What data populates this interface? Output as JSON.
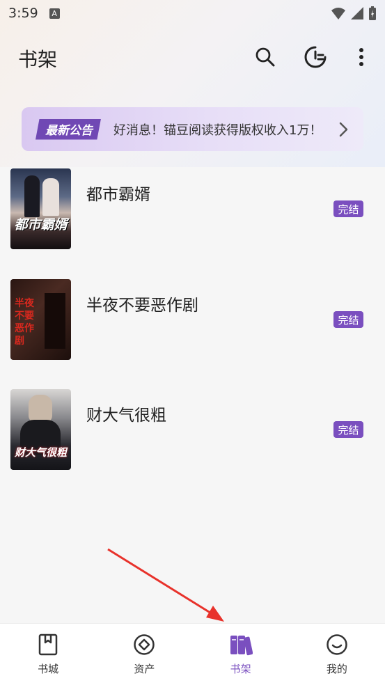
{
  "status": {
    "time": "3:59",
    "notification_letter": "A"
  },
  "header": {
    "title": "书架"
  },
  "notice": {
    "tag": "最新公告",
    "text": "好消息！锚豆阅读获得版权收入1万！"
  },
  "books": [
    {
      "title": "都市霸婿",
      "badge": "完结",
      "cover_text": "都市霸婿"
    },
    {
      "title": "半夜不要恶作剧",
      "badge": "完结",
      "cover_text": "半夜不要恶作剧"
    },
    {
      "title": "财大气很粗",
      "badge": "完结",
      "cover_text": "财大气很粗"
    }
  ],
  "tabbar": {
    "items": [
      {
        "label": "书城",
        "icon": "bookstore-icon"
      },
      {
        "label": "资产",
        "icon": "assets-icon"
      },
      {
        "label": "书架",
        "icon": "bookshelf-icon",
        "active": true
      },
      {
        "label": "我的",
        "icon": "profile-icon"
      }
    ]
  },
  "colors": {
    "accent": "#7a4fbf",
    "notice_tag": "#7048b4",
    "annotation_arrow": "#e8322b"
  }
}
